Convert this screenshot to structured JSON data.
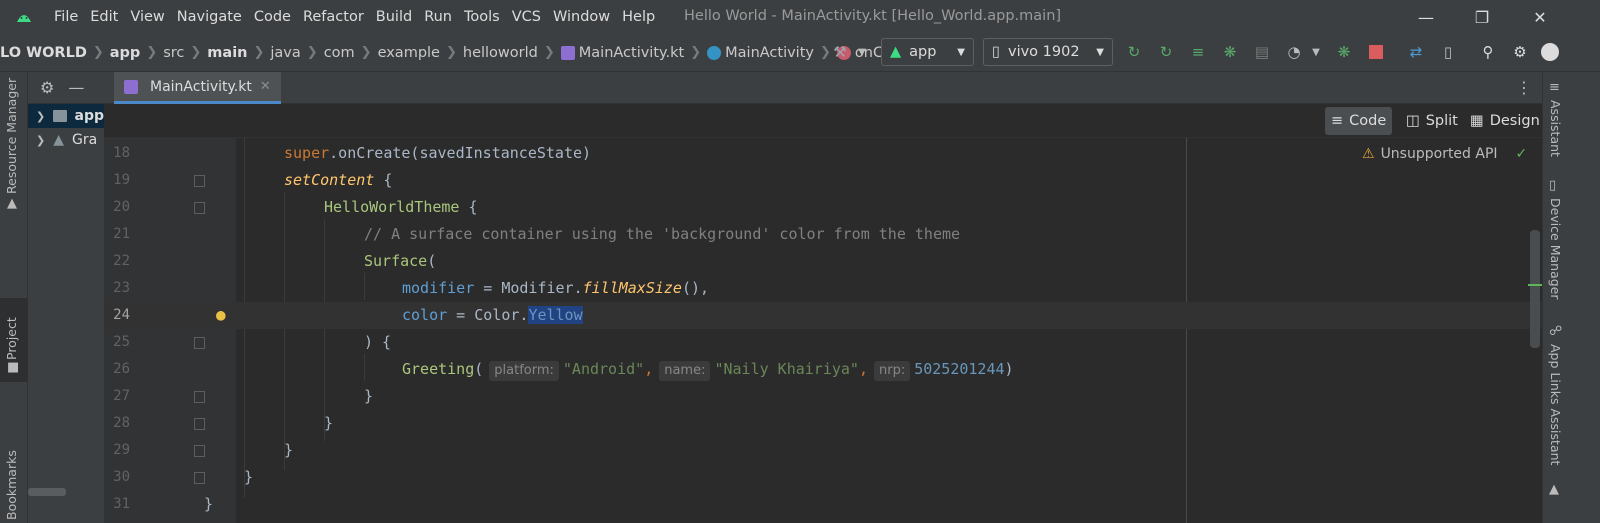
{
  "window": {
    "title": "Hello World - MainActivity.kt [Hello_World.app.main]",
    "menu": [
      "File",
      "Edit",
      "View",
      "Navigate",
      "Code",
      "Refactor",
      "Build",
      "Run",
      "Tools",
      "VCS",
      "Window",
      "Help"
    ]
  },
  "breadcrumb": {
    "project": "LO WORLD",
    "items": [
      "app",
      "src",
      "main",
      "java",
      "com",
      "example",
      "helloworld",
      "MainActivity.kt",
      "MainActivity",
      "onCreate"
    ]
  },
  "toolbar": {
    "run_config": "app",
    "device": "vivo 1902"
  },
  "left_strip": {
    "resource_manager": "Resource Manager",
    "project": "Project",
    "bookmarks": "Bookmarks"
  },
  "project_tree": [
    {
      "label": "app"
    },
    {
      "label": "Gra"
    }
  ],
  "editor": {
    "tab_label": "MainActivity.kt",
    "modes": [
      "Code",
      "Split",
      "Design"
    ],
    "warning_text": "Unsupported API",
    "line_numbers": [
      "18",
      "19",
      "20",
      "21",
      "22",
      "23",
      "24",
      "25",
      "26",
      "27",
      "28",
      "29",
      "30",
      "31"
    ],
    "code": {
      "l18_a": "super",
      "l18_b": ".onCreate(savedInstanceState)",
      "l19_a": "setContent",
      "l19_b": " {",
      "l20_a": "HelloWorldTheme",
      "l20_b": " {",
      "l21": "// A surface container using the 'background' color from the theme",
      "l22_a": "Surface",
      "l22_b": "(",
      "l23_a": "modifier",
      "l23_b": " = Modifier.",
      "l23_c": "fillMaxSize",
      "l23_d": "(),",
      "l24_a": "color",
      "l24_b": " = Color.",
      "l24_c": "Yellow",
      "l25": ") {",
      "l26_a": "Greeting",
      "l26_b": "(",
      "l26_h1": "platform:",
      "l26_s1": "\"Android\"",
      "l26_h2": "name:",
      "l26_s2": "\"Naily Khairiya\"",
      "l26_h3": "nrp:",
      "l26_n": "5025201244",
      "l26_end": ")",
      "brace": "}"
    }
  },
  "right_strip": {
    "assistant": "Assistant",
    "device_manager": "Device Manager",
    "app_links": "App Links Assistant"
  },
  "colors": {
    "accent": "#4a88c7",
    "selection": "#214283",
    "warning": "#e8a33d",
    "ok": "#5fb557"
  }
}
